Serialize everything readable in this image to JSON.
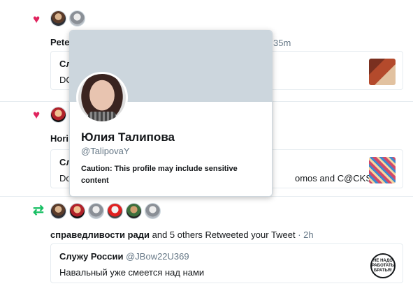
{
  "notifications": [
    {
      "type": "like",
      "icon": "heart-icon",
      "author_partial": "Pete",
      "time_partial": "35m",
      "quote": {
        "title_partial": "Сл",
        "body_partial": "DC",
        "thumb": "thumbnail-red"
      }
    },
    {
      "type": "like",
      "icon": "heart-icon",
      "author_partial": "Hori",
      "quote": {
        "title_partial": "Сл",
        "body_partial": "Do",
        "body_tail": "omos and C@CKSU...",
        "thumb": "thumbnail-crowd"
      }
    },
    {
      "type": "retweet",
      "icon": "retweet-icon",
      "author": "справедливости ради",
      "rest": " and 5 others Retweeted your Tweet",
      "time": " · 2h",
      "quote": {
        "name": "Служу России",
        "handle": " @JBow22U369",
        "body": "Навальный уже смеется над нами",
        "thumb": "thumbnail-logo",
        "logo_text": "НЕ НАДО РАБОТАТЬ БРАТЬЯ!"
      }
    }
  ],
  "hovercard": {
    "name": "Юлия Талипова",
    "handle": "@TalipovaY",
    "caution": "Caution: This profile may include sensitive content"
  },
  "colors": {
    "like": "#e0245e",
    "retweet": "#17bf63",
    "banner": "#ccd6dd",
    "secondary_text": "#657786"
  }
}
